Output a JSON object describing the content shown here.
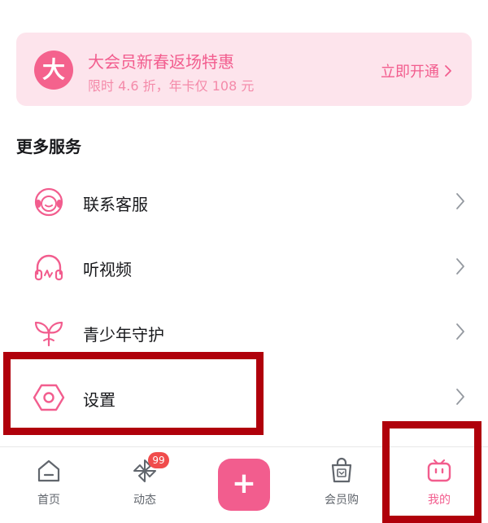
{
  "vip_banner": {
    "badge": "大",
    "title": "大会员新春返场特惠",
    "subtitle": "限时 4.6 折，年卡仅 108 元",
    "action": "立即开通"
  },
  "more_services": {
    "title": "更多服务",
    "items": [
      {
        "label": "联系客服",
        "icon": "headset-icon"
      },
      {
        "label": "听视频",
        "icon": "headphones-icon"
      },
      {
        "label": "青少年守护",
        "icon": "sprout-icon"
      },
      {
        "label": "设置",
        "icon": "hexagon-settings-icon"
      }
    ]
  },
  "tabbar": {
    "items": [
      {
        "label": "首页",
        "icon": "home-icon"
      },
      {
        "label": "动态",
        "icon": "pinwheel-icon",
        "badge": "99"
      },
      {
        "label": "",
        "icon": "plus-icon"
      },
      {
        "label": "会员购",
        "icon": "shopping-bag-icon"
      },
      {
        "label": "我的",
        "icon": "tv-face-icon",
        "active": true
      }
    ],
    "publish_symbol": "+"
  },
  "colors": {
    "accent": "#f25d8e",
    "banner_bg": "#fde4ec",
    "highlight": "#b0000b",
    "text": "#18191c",
    "muted": "#61666d"
  }
}
